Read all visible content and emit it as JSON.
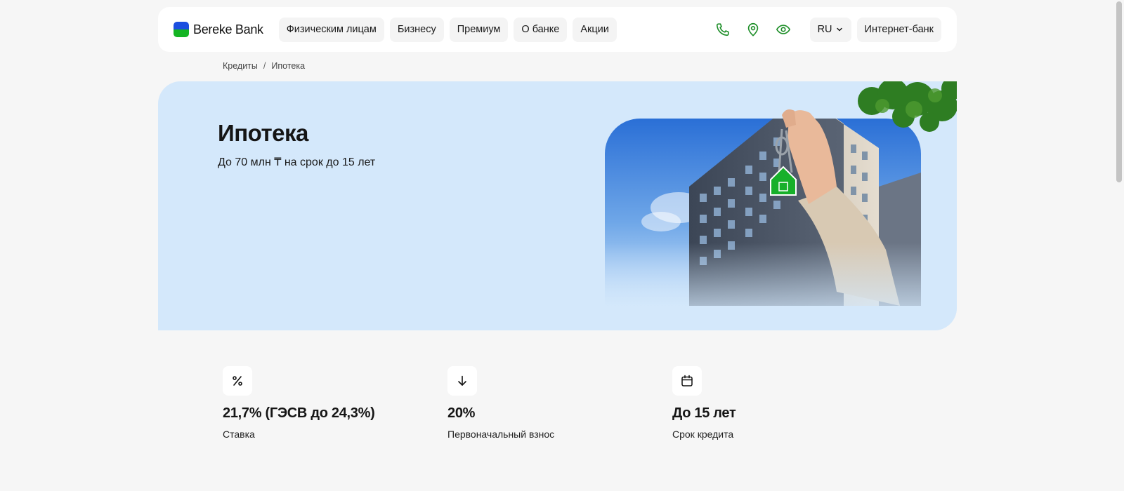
{
  "header": {
    "logo_text": "Bereke Bank",
    "nav": [
      {
        "label": "Физическим лицам"
      },
      {
        "label": "Бизнесу"
      },
      {
        "label": "Премиум"
      },
      {
        "label": "О банке"
      },
      {
        "label": "Акции"
      }
    ],
    "icons": [
      "phone-icon",
      "location-pin-icon",
      "eye-icon"
    ],
    "language": "RU",
    "internet_bank_label": "Интернет-банк"
  },
  "breadcrumb": {
    "items": [
      "Кредиты",
      "Ипотека"
    ],
    "separator": "/"
  },
  "hero": {
    "title": "Ипотека",
    "subtitle": "До 70 млн ₸ на срок до 15 лет"
  },
  "features": [
    {
      "icon": "percent-icon",
      "value": "21,7% (ГЭСВ до 24,3%)",
      "label": "Ставка"
    },
    {
      "icon": "arrow-down-icon",
      "value": "20%",
      "label": "Первоначальный взнос"
    },
    {
      "icon": "calendar-icon",
      "value": "До 15 лет",
      "label": "Срок кредита"
    }
  ],
  "colors": {
    "brand_blue": "#1b4fe0",
    "brand_green": "#14b423",
    "icon_green": "#1f8f2a",
    "hero_bg": "#d4e8fb",
    "page_bg": "#f6f6f6"
  }
}
